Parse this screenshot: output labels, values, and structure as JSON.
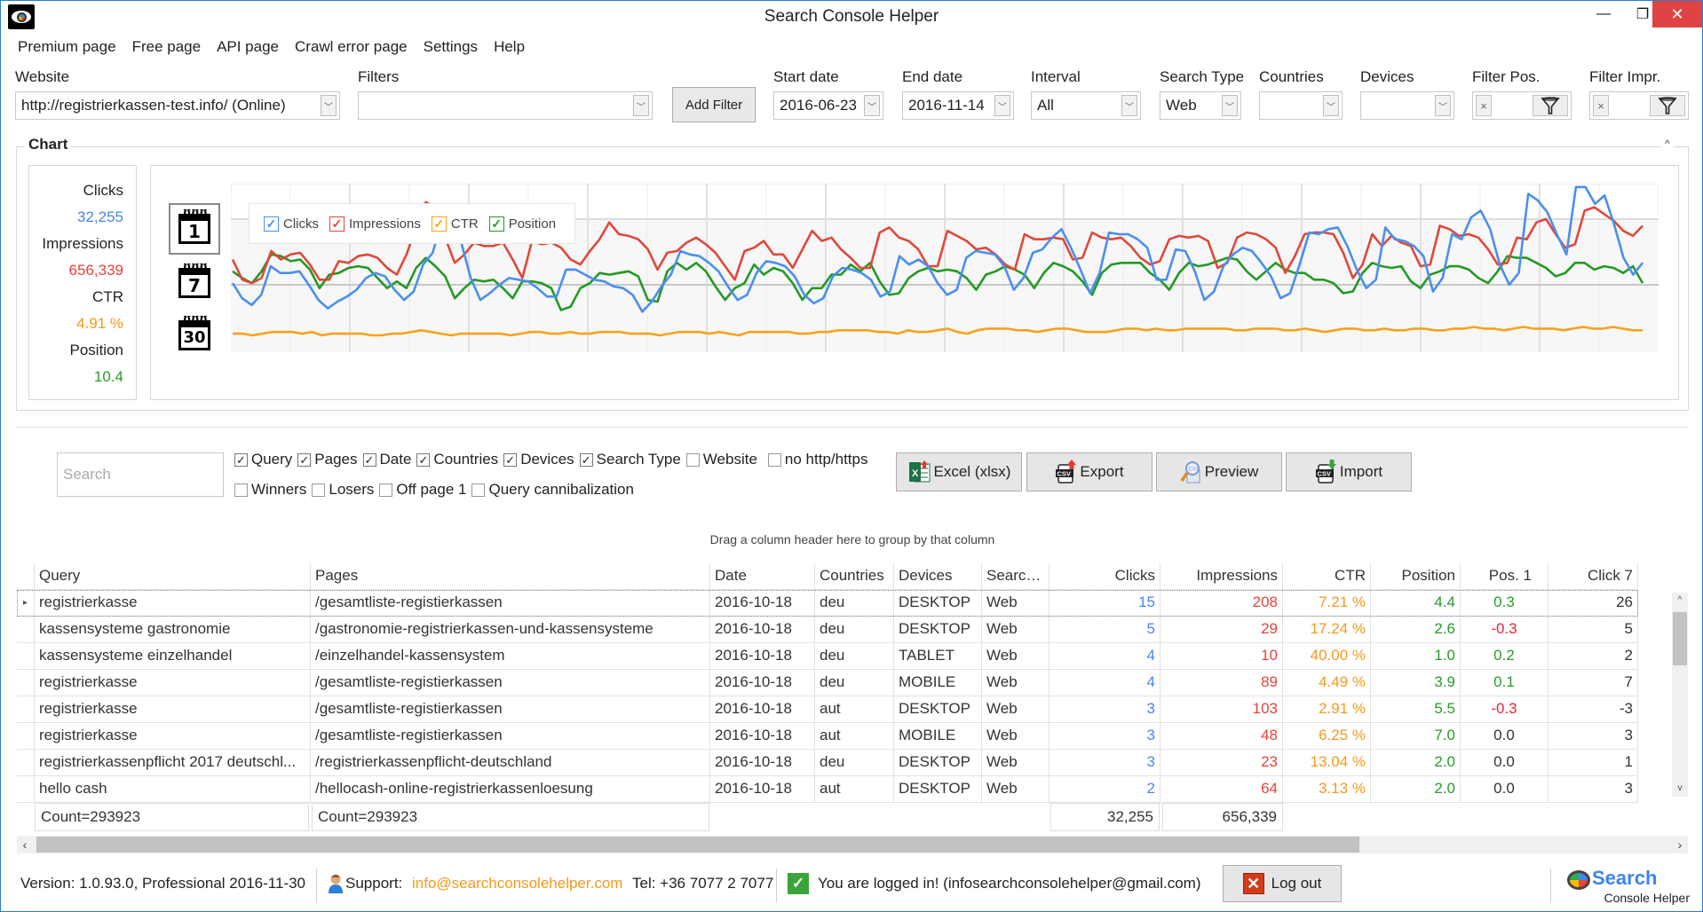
{
  "window": {
    "title": "Search Console Helper",
    "minimize_glyph": "—",
    "restore_glyph": "❐",
    "close_glyph": "✕"
  },
  "menu": [
    {
      "label": "Premium page"
    },
    {
      "label": "Free page"
    },
    {
      "label": "API page"
    },
    {
      "label": "Crawl error page"
    },
    {
      "label": "Settings"
    },
    {
      "label": "Help"
    }
  ],
  "filters": {
    "website_label": "Website",
    "website_value": "http://registrierkassen-test.info/ (Online)",
    "filters_label": "Filters",
    "filters_value": "",
    "add_filter_label": "Add Filter",
    "start_date_label": "Start date",
    "start_date_value": "2016-06-23",
    "end_date_label": "End date",
    "end_date_value": "2016-11-14",
    "interval_label": "Interval",
    "interval_value": "All",
    "search_type_label": "Search Type",
    "search_type_value": "Web",
    "countries_label": "Countries",
    "countries_value": "",
    "devices_label": "Devices",
    "devices_value": "",
    "filter_pos_label": "Filter Pos.",
    "filter_impr_label": "Filter Impr.",
    "clear_glyph": "×"
  },
  "chart_section": {
    "title": "Chart",
    "collapse_glyph": "^",
    "stats": {
      "clicks_label": "Clicks",
      "clicks_value": "32,255",
      "impressions_label": "Impressions",
      "impressions_value": "656,339",
      "ctr_label": "CTR",
      "ctr_value": "4.91 %",
      "position_label": "Position",
      "position_value": "10.4"
    },
    "interval_buttons": [
      {
        "label": "1",
        "name": "daily"
      },
      {
        "label": "7",
        "name": "weekly"
      },
      {
        "label": "30",
        "name": "monthly"
      }
    ]
  },
  "chart_data": {
    "type": "line",
    "title": "",
    "xlabel": "",
    "ylabel": "",
    "x_range": [
      "2016-06-23",
      "2016-11-14"
    ],
    "y_scale": "normalized per series (no axis labels shown)",
    "ylim": [
      0,
      1
    ],
    "grid": true,
    "legend": "top-left",
    "legend_entries": [
      "Clicks",
      "Impressions",
      "CTR",
      "Position"
    ],
    "colors": {
      "Clicks": "#4a8ff0",
      "Impressions": "#e0483a",
      "CTR": "#f9a11b",
      "Position": "#229a22"
    },
    "series": [
      {
        "name": "Clicks",
        "values": [
          0.41,
          0.32,
          0.28,
          0.34,
          0.51,
          0.47,
          0.47,
          0.48,
          0.4,
          0.31,
          0.26,
          0.3,
          0.33,
          0.37,
          0.44,
          0.47,
          0.45,
          0.37,
          0.31,
          0.36,
          0.52,
          0.59,
          0.78,
          0.86,
          0.65,
          0.44,
          0.31,
          0.35,
          0.4,
          0.44,
          0.43,
          0.42,
          0.38,
          0.33,
          0.33,
          0.49,
          0.49,
          0.46,
          0.43,
          0.42,
          0.39,
          0.38,
          0.34,
          0.24,
          0.3,
          0.39,
          0.46,
          0.6,
          0.58,
          0.57,
          0.53,
          0.48,
          0.39,
          0.31,
          0.34,
          0.47,
          0.54,
          0.53,
          0.51,
          0.45,
          0.34,
          0.29,
          0.32,
          0.45,
          0.5,
          0.49,
          0.47,
          0.43,
          0.33,
          0.36,
          0.57,
          0.52,
          0.55,
          0.51,
          0.41,
          0.34,
          0.37,
          0.56,
          0.6,
          0.59,
          0.58,
          0.51,
          0.37,
          0.44,
          0.59,
          0.61,
          0.68,
          0.73,
          0.62,
          0.49,
          0.35,
          0.47,
          0.71,
          0.7,
          0.7,
          0.67,
          0.62,
          0.43,
          0.43,
          0.61,
          0.6,
          0.48,
          0.31,
          0.36,
          0.51,
          0.58,
          0.62,
          0.6,
          0.53,
          0.45,
          0.32,
          0.35,
          0.52,
          0.71,
          0.7,
          0.73,
          0.74,
          0.63,
          0.49,
          0.38,
          0.43,
          0.74,
          0.67,
          0.66,
          0.63,
          0.57,
          0.36,
          0.44,
          0.7,
          0.67,
          0.8,
          0.84,
          0.73,
          0.52,
          0.4,
          0.47,
          0.94,
          0.9,
          0.83,
          0.7,
          0.58,
          0.98,
          0.98,
          0.88,
          0.93,
          0.76,
          0.56,
          0.46,
          0.53
        ]
      },
      {
        "name": "Impressions",
        "values": [
          0.55,
          0.43,
          0.41,
          0.44,
          0.6,
          0.55,
          0.58,
          0.59,
          0.52,
          0.43,
          0.43,
          0.54,
          0.53,
          0.57,
          0.58,
          0.56,
          0.5,
          0.46,
          0.58,
          0.74,
          0.89,
          0.86,
          0.68,
          0.53,
          0.58,
          0.65,
          0.63,
          0.63,
          0.65,
          0.55,
          0.44,
          0.66,
          0.64,
          0.65,
          0.62,
          0.55,
          0.52,
          0.6,
          0.67,
          0.77,
          0.7,
          0.69,
          0.67,
          0.61,
          0.49,
          0.59,
          0.6,
          0.65,
          0.68,
          0.64,
          0.59,
          0.51,
          0.43,
          0.6,
          0.62,
          0.66,
          0.58,
          0.58,
          0.5,
          0.61,
          0.72,
          0.66,
          0.68,
          0.61,
          0.56,
          0.5,
          0.5,
          0.71,
          0.74,
          0.68,
          0.66,
          0.61,
          0.51,
          0.51,
          0.72,
          0.69,
          0.66,
          0.61,
          0.62,
          0.58,
          0.52,
          0.49,
          0.7,
          0.67,
          0.67,
          0.68,
          0.67,
          0.55,
          0.56,
          0.71,
          0.68,
          0.67,
          0.68,
          0.63,
          0.56,
          0.52,
          0.54,
          0.67,
          0.69,
          0.68,
          0.69,
          0.66,
          0.5,
          0.53,
          0.68,
          0.71,
          0.7,
          0.67,
          0.62,
          0.47,
          0.57,
          0.7,
          0.71,
          0.71,
          0.7,
          0.59,
          0.44,
          0.52,
          0.7,
          0.63,
          0.69,
          0.65,
          0.63,
          0.51,
          0.52,
          0.75,
          0.73,
          0.69,
          0.7,
          0.68,
          0.61,
          0.52,
          0.53,
          0.68,
          0.67,
          0.77,
          0.79,
          0.7,
          0.62,
          0.64,
          0.84,
          0.86,
          0.82,
          0.78,
          0.72,
          0.69,
          0.75
        ]
      },
      {
        "name": "CTR",
        "values": [
          0.11,
          0.11,
          0.1,
          0.11,
          0.12,
          0.12,
          0.12,
          0.11,
          0.12,
          0.1,
          0.11,
          0.11,
          0.11,
          0.11,
          0.1,
          0.1,
          0.11,
          0.11,
          0.12,
          0.13,
          0.12,
          0.11,
          0.1,
          0.11,
          0.11,
          0.11,
          0.11,
          0.11,
          0.1,
          0.11,
          0.12,
          0.12,
          0.11,
          0.11,
          0.12,
          0.11,
          0.11,
          0.12,
          0.12,
          0.12,
          0.11,
          0.11,
          0.11,
          0.1,
          0.11,
          0.12,
          0.12,
          0.12,
          0.11,
          0.12,
          0.11,
          0.1,
          0.12,
          0.12,
          0.12,
          0.12,
          0.12,
          0.11,
          0.11,
          0.12,
          0.12,
          0.13,
          0.13,
          0.13,
          0.13,
          0.12,
          0.12,
          0.11,
          0.13,
          0.12,
          0.12,
          0.13,
          0.14,
          0.12,
          0.11,
          0.13,
          0.14,
          0.14,
          0.14,
          0.13,
          0.13,
          0.12,
          0.13,
          0.14,
          0.14,
          0.13,
          0.12,
          0.12,
          0.12,
          0.13,
          0.14,
          0.14,
          0.13,
          0.14,
          0.13,
          0.13,
          0.14,
          0.14,
          0.14,
          0.14,
          0.14,
          0.13,
          0.13,
          0.14,
          0.14,
          0.14,
          0.13,
          0.13,
          0.14,
          0.13,
          0.12,
          0.13,
          0.14,
          0.14,
          0.13,
          0.13,
          0.14,
          0.13,
          0.13,
          0.14,
          0.14,
          0.13,
          0.13,
          0.14,
          0.14,
          0.15,
          0.14,
          0.14,
          0.13,
          0.14,
          0.15,
          0.14,
          0.14,
          0.14,
          0.13,
          0.14,
          0.15,
          0.14,
          0.14,
          0.15,
          0.14,
          0.13,
          0.13
        ]
      },
      {
        "name": "Position",
        "values": [
          0.48,
          0.44,
          0.41,
          0.48,
          0.58,
          0.57,
          0.54,
          0.55,
          0.49,
          0.38,
          0.46,
          0.47,
          0.5,
          0.51,
          0.5,
          0.44,
          0.38,
          0.42,
          0.38,
          0.5,
          0.56,
          0.51,
          0.45,
          0.32,
          0.38,
          0.43,
          0.42,
          0.43,
          0.38,
          0.32,
          0.42,
          0.42,
          0.41,
          0.38,
          0.25,
          0.27,
          0.38,
          0.41,
          0.47,
          0.46,
          0.47,
          0.48,
          0.45,
          0.31,
          0.3,
          0.48,
          0.53,
          0.49,
          0.53,
          0.48,
          0.39,
          0.31,
          0.38,
          0.41,
          0.52,
          0.46,
          0.5,
          0.48,
          0.41,
          0.31,
          0.38,
          0.38,
          0.46,
          0.46,
          0.52,
          0.48,
          0.53,
          0.42,
          0.34,
          0.35,
          0.44,
          0.48,
          0.5,
          0.48,
          0.49,
          0.48,
          0.44,
          0.37,
          0.46,
          0.48,
          0.51,
          0.49,
          0.46,
          0.38,
          0.47,
          0.53,
          0.51,
          0.48,
          0.42,
          0.34,
          0.47,
          0.52,
          0.53,
          0.53,
          0.53,
          0.47,
          0.43,
          0.37,
          0.47,
          0.53,
          0.51,
          0.52,
          0.54,
          0.56,
          0.55,
          0.48,
          0.43,
          0.48,
          0.53,
          0.49,
          0.47,
          0.47,
          0.43,
          0.43,
          0.41,
          0.35,
          0.36,
          0.47,
          0.53,
          0.51,
          0.5,
          0.51,
          0.42,
          0.38,
          0.46,
          0.48,
          0.51,
          0.51,
          0.49,
          0.44,
          0.41,
          0.48,
          0.57,
          0.56,
          0.56,
          0.53,
          0.5,
          0.45,
          0.47,
          0.53,
          0.53,
          0.49,
          0.51,
          0.5,
          0.47,
          0.51,
          0.41
        ]
      }
    ]
  },
  "toolbar": {
    "search_placeholder": "Search",
    "checkboxes_row1": [
      {
        "label": "Query",
        "checked": true
      },
      {
        "label": "Pages",
        "checked": true
      },
      {
        "label": "Date",
        "checked": true
      },
      {
        "label": "Countries",
        "checked": true
      },
      {
        "label": "Devices",
        "checked": true
      },
      {
        "label": "Search Type",
        "checked": true
      },
      {
        "label": "Website",
        "checked": false
      },
      {
        "label": "no http/https",
        "checked": false
      }
    ],
    "checkboxes_row2": [
      {
        "label": "Winners",
        "checked": false
      },
      {
        "label": "Losers",
        "checked": false
      },
      {
        "label": "Off page 1",
        "checked": false
      },
      {
        "label": "Query cannibalization",
        "checked": false
      }
    ],
    "excel_label": "Excel (xlsx)",
    "export_label": "Export",
    "preview_label": "Preview",
    "import_label": "Import",
    "group_hint": "Drag a column header here to group by that column",
    "check_glyph": "✓"
  },
  "grid": {
    "columns": [
      "Query",
      "Pages",
      "Date",
      "Countries",
      "Devices",
      "Search T",
      "Clicks",
      "Impressions",
      "CTR",
      "Position",
      "Pos. 1",
      "Click 7"
    ],
    "rows": [
      [
        "registrierkasse",
        "/gesamtliste-registierkassen",
        "2016-10-18",
        "deu",
        "DESKTOP",
        "Web",
        "15",
        "208",
        "7.21 %",
        "4.4",
        "0.3",
        "26"
      ],
      [
        "kassensysteme gastronomie",
        "/gastronomie-registrierkassen-und-kassensysteme",
        "2016-10-18",
        "deu",
        "DESKTOP",
        "Web",
        "5",
        "29",
        "17.24 %",
        "2.6",
        "-0.3",
        "5"
      ],
      [
        "kassensysteme einzelhandel",
        "/einzelhandel-kassensystem",
        "2016-10-18",
        "deu",
        "TABLET",
        "Web",
        "4",
        "10",
        "40.00 %",
        "1.0",
        "0.2",
        "2"
      ],
      [
        "registrierkasse",
        "/gesamtliste-registierkassen",
        "2016-10-18",
        "deu",
        "MOBILE",
        "Web",
        "4",
        "89",
        "4.49 %",
        "3.9",
        "0.1",
        "7"
      ],
      [
        "registrierkasse",
        "/gesamtliste-registierkassen",
        "2016-10-18",
        "aut",
        "DESKTOP",
        "Web",
        "3",
        "103",
        "2.91 %",
        "5.5",
        "-0.3",
        "-3"
      ],
      [
        "registrierkasse",
        "/gesamtliste-registierkassen",
        "2016-10-18",
        "aut",
        "MOBILE",
        "Web",
        "3",
        "48",
        "6.25 %",
        "7.0",
        "0.0",
        "3"
      ],
      [
        "registrierkassenpflicht 2017 deutschl...",
        "/registrierkassenpflicht-deutschland",
        "2016-10-18",
        "deu",
        "DESKTOP",
        "Web",
        "3",
        "23",
        "13.04 %",
        "2.0",
        "0.0",
        "1"
      ],
      [
        "hello cash",
        "/hellocash-online-registrierkassenloesung",
        "2016-10-18",
        "aut",
        "DESKTOP",
        "Web",
        "2",
        "64",
        "3.13 %",
        "2.0",
        "0.0",
        "3"
      ]
    ],
    "footer": {
      "query_count": "Count=293923",
      "pages_count": "Count=293923",
      "clicks_total": "32,255",
      "impressions_total": "656,339"
    },
    "current_row_glyph": "▸",
    "scroll_up_glyph": "^",
    "scroll_down_glyph": "v",
    "scroll_left_glyph": "‹",
    "scroll_right_glyph": "›",
    "vertical_scroll_fraction": 0.0,
    "horizontal_scroll_fraction": 0.0
  },
  "status_bar": {
    "version": "Version:  1.0.93.0,  Professional 2016-11-30",
    "support_label": "Support:",
    "support_email": "info@searchconsolehelper.com",
    "tel": "Tel: +36 7077 2 7077",
    "login_status": "You are logged in! (infosearchconsolehelper@gmail.com)",
    "logout_label": "Log out",
    "brand_search": "Search",
    "brand_sub": "Console Helper"
  },
  "colors": {
    "clicks": "#4a86e8",
    "impressions": "#e0453a",
    "ctr": "#f39a1e",
    "position": "#2a9a2a",
    "negative": "#e8243a",
    "close_button": "#e04343",
    "email_link": "#f39a1e"
  }
}
